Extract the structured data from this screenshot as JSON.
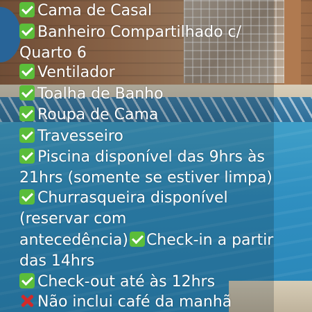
{
  "lines": [
    {
      "icon": "check-icon",
      "text": "Cama de Casal"
    },
    {
      "icon": "check-icon",
      "text": "Banheiro Compartilhado c/"
    },
    {
      "icon": "",
      "text": "Quarto 6"
    },
    {
      "icon": "check-icon",
      "text": "Ventilador"
    },
    {
      "icon": "check-icon",
      "text": "Toalha de Banho"
    },
    {
      "icon": "check-icon",
      "text": "Roupa de Cama"
    },
    {
      "icon": "check-icon",
      "text": "Travesseiro"
    },
    {
      "icon": "check-icon",
      "text": "Piscina disponível das 9hrs às"
    },
    {
      "icon": "",
      "text": "21hrs (somente se estiver limpa)"
    },
    {
      "icon": "check-icon",
      "text": "Churrasqueira disponível"
    },
    {
      "icon": "",
      "text": "(reservar com"
    },
    {
      "icon": "",
      "text": "antecedência)",
      "inline_icon": "check-icon",
      "text2": "Check-in a partir"
    },
    {
      "icon": "",
      "text": "das 14hrs"
    },
    {
      "icon": "check-icon",
      "text": "Check-out até às 12hrs"
    },
    {
      "icon": "cross-icon",
      "text": "Não inclui café da manhã"
    }
  ],
  "colors": {
    "check": "#5bbd3a",
    "cross": "#d22a2a",
    "text": "#ffffff",
    "pool": "#2f8fc0"
  }
}
